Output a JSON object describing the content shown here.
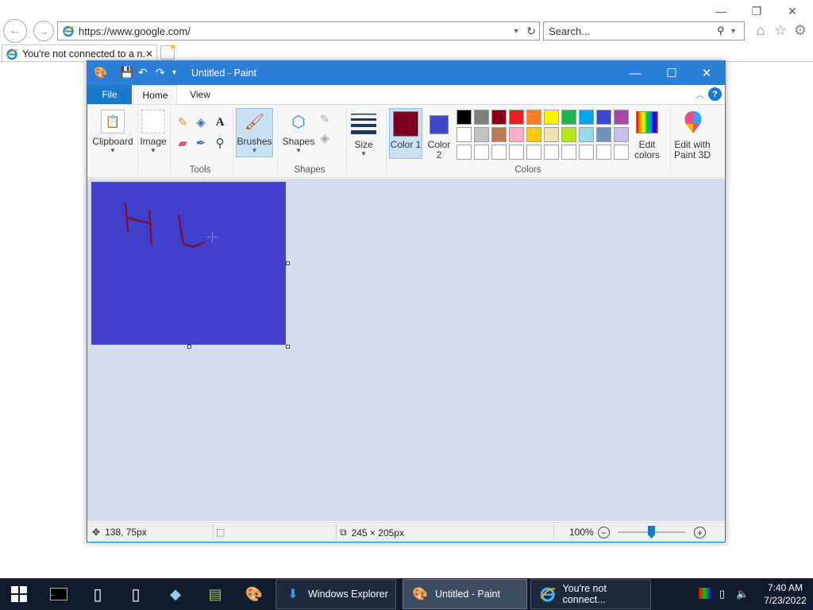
{
  "browser": {
    "url": "https://www.google.com/",
    "search_placeholder": "Search...",
    "tab_title": "You're not connected to a n...",
    "tab_close": "✕"
  },
  "paint": {
    "window_title": "Untitled - Paint",
    "ribbon_tabs": {
      "file": "File",
      "home": "Home",
      "view": "View"
    },
    "help": "?",
    "groups": {
      "clipboard": "Clipboard",
      "image": "Image",
      "tools": "Tools",
      "brushes": "Brushes",
      "shapes_btn": "Shapes",
      "shapes": "Shapes",
      "size": "Size",
      "color1": "Color 1",
      "color2": "Color 2",
      "edit_colors": "Edit colors",
      "edit_paint3d": "Edit with Paint 3D",
      "colors": "Colors"
    },
    "color1_value": "#7d0020",
    "color2_value": "#3f48cc",
    "palette_row1": [
      "#000000",
      "#7f7f7f",
      "#880015",
      "#ed1c24",
      "#ff7f27",
      "#fff200",
      "#22b14c",
      "#00a2e8",
      "#3f48cc",
      "#a349a4"
    ],
    "palette_row2": [
      "#ffffff",
      "#c3c3c3",
      "#b97a57",
      "#ffaec9",
      "#ffc90e",
      "#efe4b0",
      "#b5e61d",
      "#99d9ea",
      "#7092be",
      "#c8bfe7"
    ],
    "canvas_color": "#4040cd",
    "stroke_color": "#8a0a2a",
    "status": {
      "cursor_pos": "138, 75px",
      "canvas_size": "245 × 205px",
      "zoom": "100%",
      "zoom_level_percent": 100
    }
  },
  "taskbar": {
    "apps": [
      {
        "label": "Windows Explorer",
        "active": false
      },
      {
        "label": "Untitled - Paint",
        "active": true
      },
      {
        "label": "You're not connect...",
        "active": false
      }
    ],
    "time": "7:40 AM",
    "date": "7/23/2022"
  }
}
